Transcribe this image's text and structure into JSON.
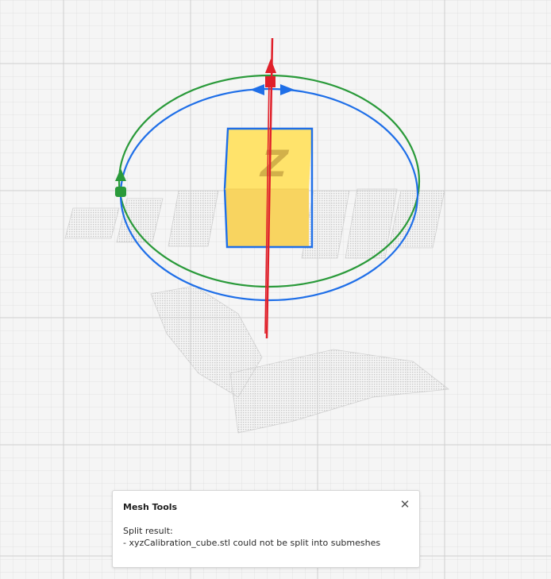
{
  "notification": {
    "title": "Mesh Tools",
    "close_glyph": "✕",
    "message_heading": "Split result:",
    "message_line": "- xyzCalibration_cube.stl could not be split into submeshes"
  },
  "model": {
    "face_letter": "Z",
    "colors": {
      "cube_top": "#ffe36b",
      "cube_front": "#f8d460",
      "selection_outline": "#1f6fe8",
      "axis_x": "#1f6fe8",
      "axis_y": "#2a9a3a",
      "axis_z": "#e0202a"
    }
  },
  "icons": {
    "close": "close-icon"
  }
}
